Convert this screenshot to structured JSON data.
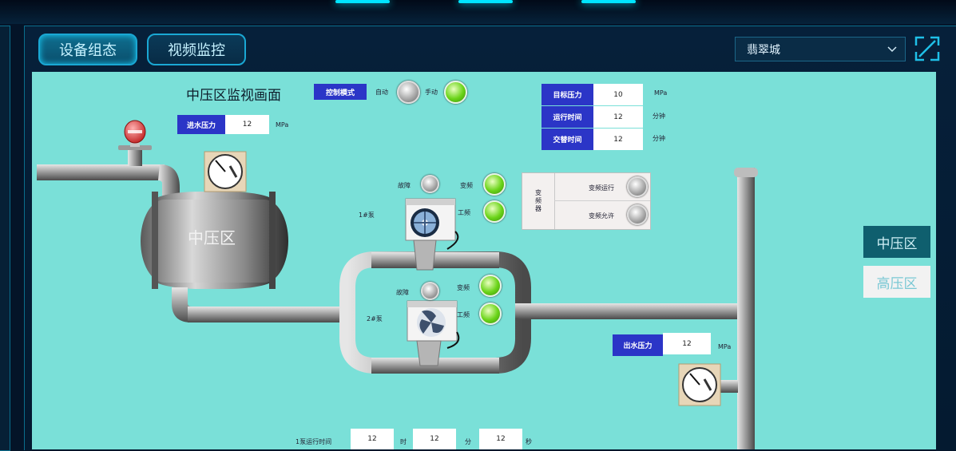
{
  "tabs": {
    "equipment": "设备组态",
    "video": "视频监控"
  },
  "location_select": {
    "value": "翡翠城"
  },
  "scene": {
    "title": "中压区监视画面",
    "control_mode": {
      "button": "控制模式",
      "auto": "自动",
      "manual": "手动"
    },
    "inlet_pressure": {
      "label": "进水压力",
      "value": "12",
      "unit": "MPa"
    },
    "target_pressure": {
      "label": "目标压力",
      "value": "10",
      "unit": "MPa"
    },
    "run_time": {
      "label": "运行时间",
      "value": "12",
      "unit": "分钟"
    },
    "switch_time": {
      "label": "交替时间",
      "value": "12",
      "unit": "分钟"
    },
    "tank_label": "中压区",
    "pump1": {
      "label": "1#泵",
      "fault": "故障",
      "vfd": "变频",
      "power": "工频"
    },
    "pump2": {
      "label": "2#泵",
      "fault": "故障",
      "vfd": "变频",
      "power": "工频"
    },
    "vfd_panel": {
      "title": "变频器",
      "running": "变频运行",
      "allow": "变频允许"
    },
    "outlet_pressure": {
      "label": "出水压力",
      "value": "12",
      "unit": "MPa"
    },
    "pump1_runtime": {
      "label": "1泵运行时间",
      "hours": "12",
      "hours_unit": "时",
      "minutes": "12",
      "minutes_unit": "分",
      "seconds": "12",
      "seconds_unit": "秒"
    }
  },
  "zones": {
    "medium": "中压区",
    "high": "高压区"
  },
  "colors": {
    "canvas": "#7ae0d8",
    "label_blue": "#2b35c7",
    "lamp_green": "#6ad418",
    "zone_active": "#0f5f6e"
  }
}
